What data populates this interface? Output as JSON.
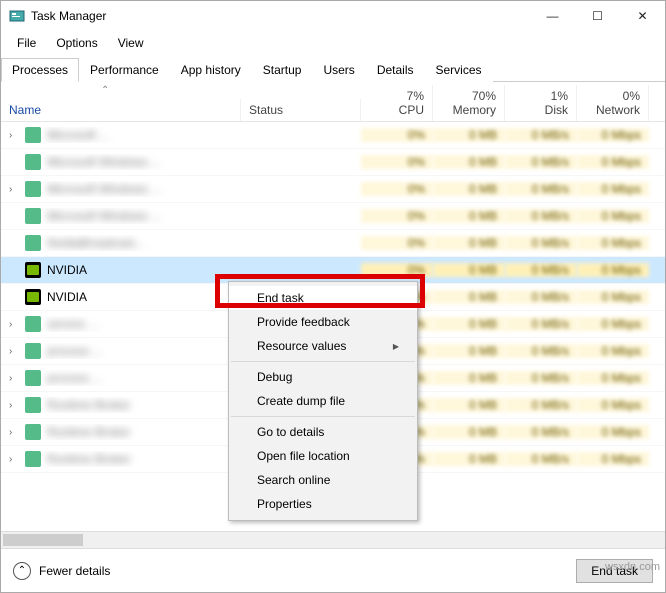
{
  "window": {
    "title": "Task Manager"
  },
  "winbuttons": {
    "min": "—",
    "max": "☐",
    "close": "✕"
  },
  "menubar": [
    "File",
    "Options",
    "View"
  ],
  "tabs": [
    "Processes",
    "Performance",
    "App history",
    "Startup",
    "Users",
    "Details",
    "Services"
  ],
  "active_tab": 0,
  "columns": {
    "name": "Name",
    "status": "Status",
    "cpu": {
      "pct": "7%",
      "label": "CPU"
    },
    "memory": {
      "pct": "70%",
      "label": "Memory"
    },
    "disk": {
      "pct": "1%",
      "label": "Disk"
    },
    "network": {
      "pct": "0%",
      "label": "Network"
    }
  },
  "rows": [
    {
      "exp": true,
      "icon": "app",
      "name": "Microsoft ...",
      "blur": true
    },
    {
      "exp": false,
      "icon": "app",
      "name": "Microsoft Windows ...",
      "blur": true
    },
    {
      "exp": true,
      "icon": "app",
      "name": "Microsoft Windows ...",
      "blur": true
    },
    {
      "exp": false,
      "icon": "app",
      "name": "Microsoft Windows ...",
      "blur": true
    },
    {
      "exp": false,
      "icon": "app",
      "name": "NvidiaBroadcast...",
      "blur": true
    },
    {
      "exp": false,
      "icon": "nv",
      "name": "NVIDIA",
      "blur": false,
      "selected": true
    },
    {
      "exp": false,
      "icon": "nv",
      "name": "NVIDIA",
      "blur": false
    },
    {
      "exp": true,
      "icon": "app",
      "name": "service ...",
      "blur": true
    },
    {
      "exp": true,
      "icon": "app",
      "name": "process ...",
      "blur": true
    },
    {
      "exp": true,
      "icon": "app",
      "name": "process ...",
      "blur": true
    },
    {
      "exp": true,
      "icon": "app",
      "name": "Runtime Broker",
      "blur": true
    },
    {
      "exp": true,
      "icon": "app",
      "name": "Runtime Broker",
      "blur": true
    },
    {
      "exp": true,
      "icon": "app",
      "name": "Runtime Broker",
      "blur": true
    }
  ],
  "row_values": {
    "cpu": "0%",
    "memory": "",
    "disk": "",
    "network": ""
  },
  "context_menu": {
    "items": [
      "End task",
      "Provide feedback",
      "Resource values",
      "-",
      "Debug",
      "Create dump file",
      "-",
      "Go to details",
      "Open file location",
      "Search online",
      "Properties"
    ],
    "highlighted": 0,
    "submenu_indicator_index": 2
  },
  "footer": {
    "fewer": "Fewer details",
    "end_task": "End task"
  },
  "watermark": "wsxdn.com"
}
